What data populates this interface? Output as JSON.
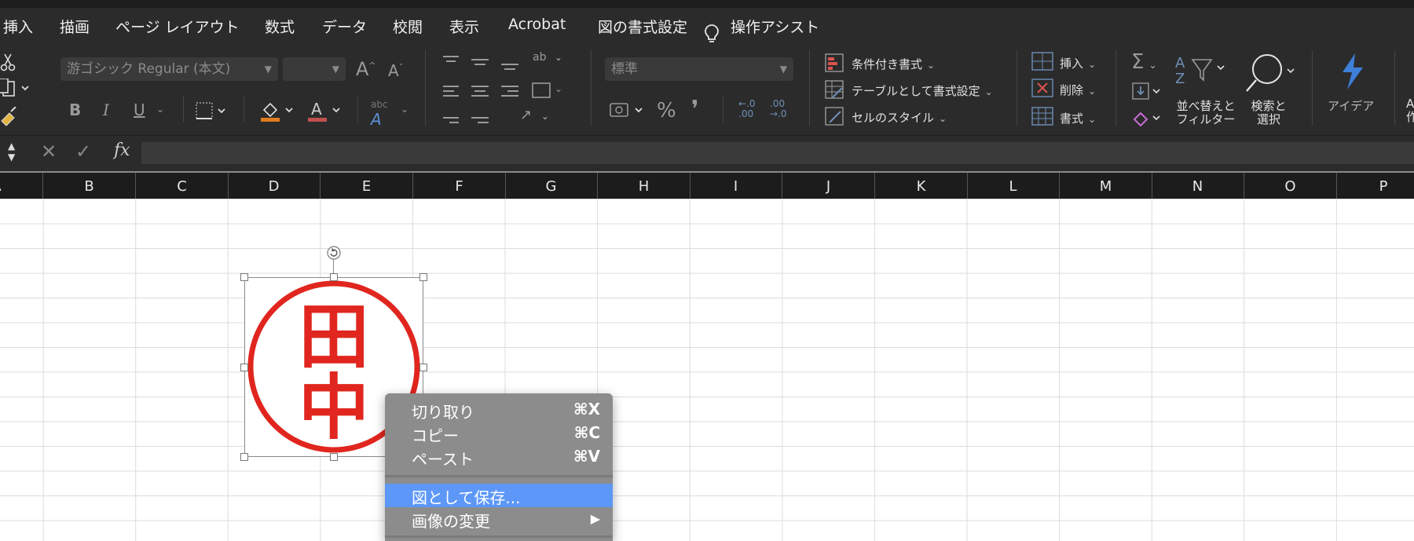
{
  "menu_tabs": [
    "挿入",
    "描画",
    "ページ レイアウト",
    "数式",
    "データ",
    "校閲",
    "表示",
    "Acrobat",
    "図の書式設定",
    "操作アシスト"
  ],
  "ribbon": {
    "font_name": "游ゴシック Regular (本文)",
    "number_format": "標準",
    "conditional_format": "条件付き書式",
    "format_as_table": "テーブルとして書式設定",
    "cell_styles": "セルのスタイル",
    "insert": "挿入",
    "delete": "削除",
    "format": "書式",
    "sort_filter_line1": "並べ替えと",
    "sort_filter_line2": "フィルター",
    "find_select_line1": "検索と",
    "find_select_line2": "選択",
    "ideas": "アイデア",
    "edge_right": "A",
    "edge_right2": "作",
    "bold": "B",
    "italic": "I",
    "underline": "U",
    "percent": "%",
    "comma": "❜",
    "font_grow": "A",
    "font_shrink": "A",
    "abc_label": "abc",
    "ab_label": "ab",
    "increase_decimal_from": ".0",
    "increase_decimal_to": ".00",
    "decrease_decimal_from": ".00",
    "decrease_decimal_to": ".0"
  },
  "formula_bar": {
    "fx": "fx"
  },
  "columns": [
    "A",
    "B",
    "C",
    "D",
    "E",
    "F",
    "G",
    "H",
    "I",
    "J",
    "K",
    "L",
    "M",
    "N",
    "O",
    "P"
  ],
  "stamp": {
    "kanji_top": "田",
    "kanji_bottom": "中",
    "color": "#e0261e"
  },
  "context_menu": {
    "items": [
      {
        "label": "切り取り",
        "shortcut": "⌘X"
      },
      {
        "label": "コピー",
        "shortcut": "⌘C"
      },
      {
        "label": "ペースト",
        "shortcut": "⌘V"
      },
      {
        "label": "図として保存...",
        "shortcut": ""
      },
      {
        "label": "画像の変更",
        "shortcut": "▶"
      }
    ],
    "highlight_color": "#5d97f7"
  }
}
